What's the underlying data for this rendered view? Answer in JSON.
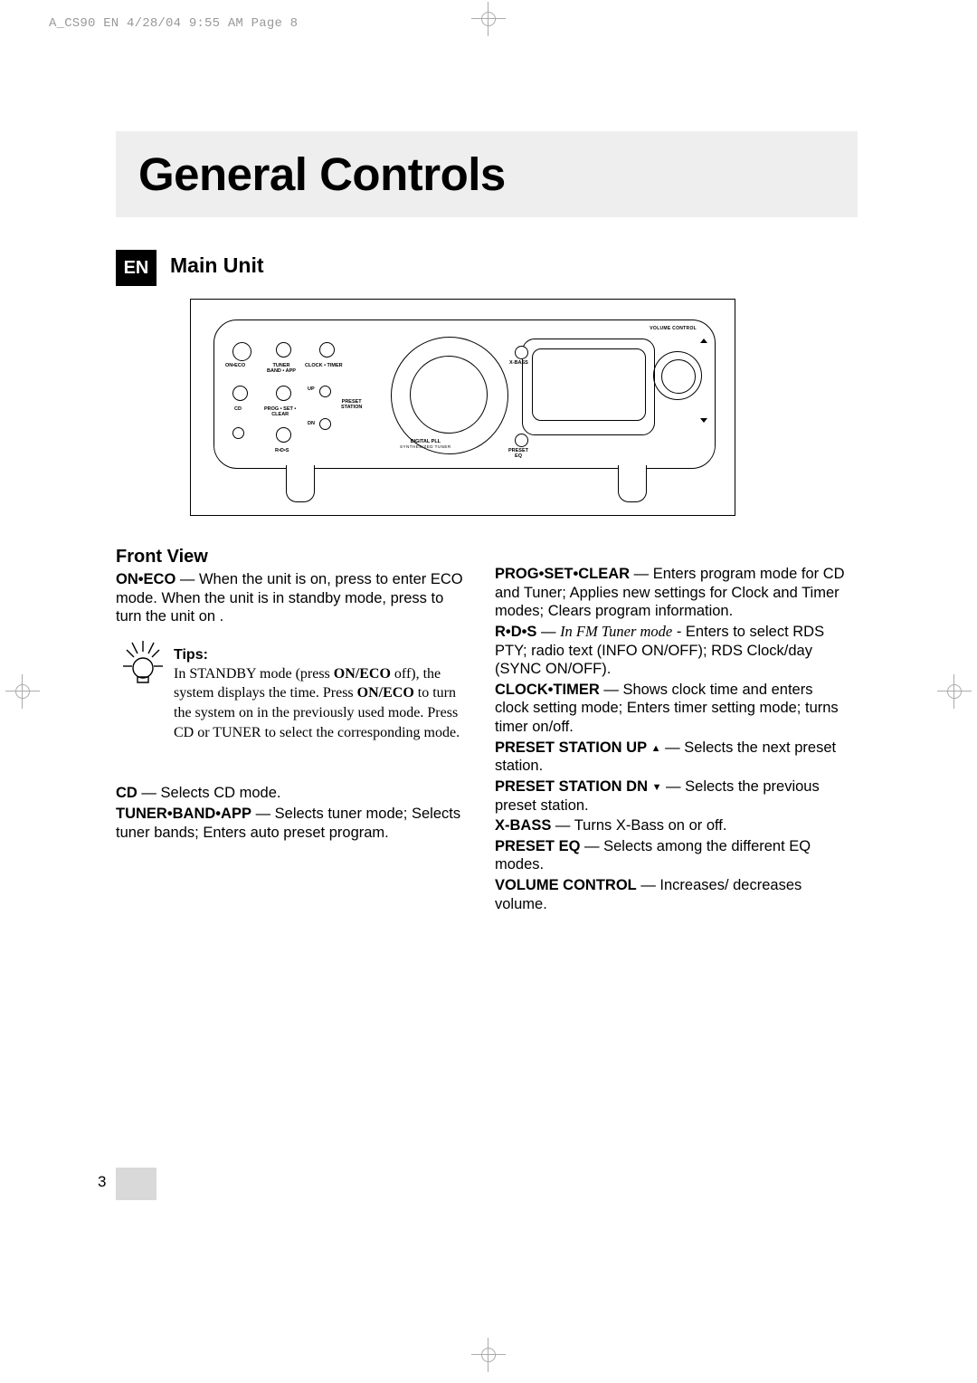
{
  "print_header": "A_CS90 EN  4/28/04  9:55 AM  Page 8",
  "title": "General Controls",
  "lang_tag": "EN",
  "section_heading": "Main Unit",
  "diagram": {
    "volume_label": "VOLUME CONTROL",
    "btn_on_eco": "ON•ECO",
    "btn_tuner": "TUNER\nBAND • APP",
    "btn_clock": "CLOCK • TIMER",
    "btn_cd": "CD",
    "btn_prog": "PROG • SET •\nCLEAR",
    "btn_preset": "PRESET\nSTATION",
    "btn_up": "UP",
    "btn_dn": "DN",
    "btn_rds": "R•D•S",
    "btn_xbass": "X-BASS",
    "btn_preset_eq": "PRESET\nEQ",
    "pll_top": "DIGITAL PLL",
    "pll_sub": "SYNTHESIZED TUNER"
  },
  "front_view_heading": "Front View",
  "left": {
    "on_eco_label": "ON•ECO",
    "on_eco_text": " — When the unit is on, press to enter ECO mode. When the unit is in standby mode, press to turn the unit on .",
    "tips_title": "Tips:",
    "tips_body_1": "In STANDBY mode (press ",
    "tips_bold_1": "ON/ECO",
    "tips_body_2": " off), the system displays the time. Press ",
    "tips_bold_2": "ON/ECO",
    "tips_body_3": " to turn the system on in the previously used mode.  Press CD or TUNER to select the corresponding mode.",
    "cd_label": "CD",
    "cd_text": " — Selects CD mode.",
    "tuner_label": "TUNER•BAND•APP",
    "tuner_text": " — Selects tuner mode; Selects tuner bands; Enters auto preset program."
  },
  "right": {
    "prog_label": "PROG•SET•CLEAR",
    "prog_text": " — Enters program mode for CD and Tuner; Applies new settings for Clock and Timer modes; Clears program information.",
    "rds_label": "R•D•S",
    "rds_ital": "In FM Tuner mode",
    "rds_text": " - Enters to select RDS PTY; radio text (INFO ON/OFF); RDS Clock/day (SYNC ON/OFF).",
    "clock_label": "CLOCK•TIMER",
    "clock_text": " — Shows clock time and enters clock setting mode; Enters timer setting mode; turns timer on/off.",
    "psu_label": "PRESET STATION UP",
    "psu_text": "  — Selects the next preset station.",
    "psd_label": "PRESET STATION DN",
    "psd_text": "  — Selects the previous preset station.",
    "xbass_label": "X-BASS",
    "xbass_text": " — Turns X-Bass on or off.",
    "peq_label": "PRESET EQ ",
    "peq_text": " — Selects among the different EQ modes.",
    "vol_label": "VOLUME CONTROL",
    "vol_text": " — Increases/ decreases volume."
  },
  "page_number": "3"
}
